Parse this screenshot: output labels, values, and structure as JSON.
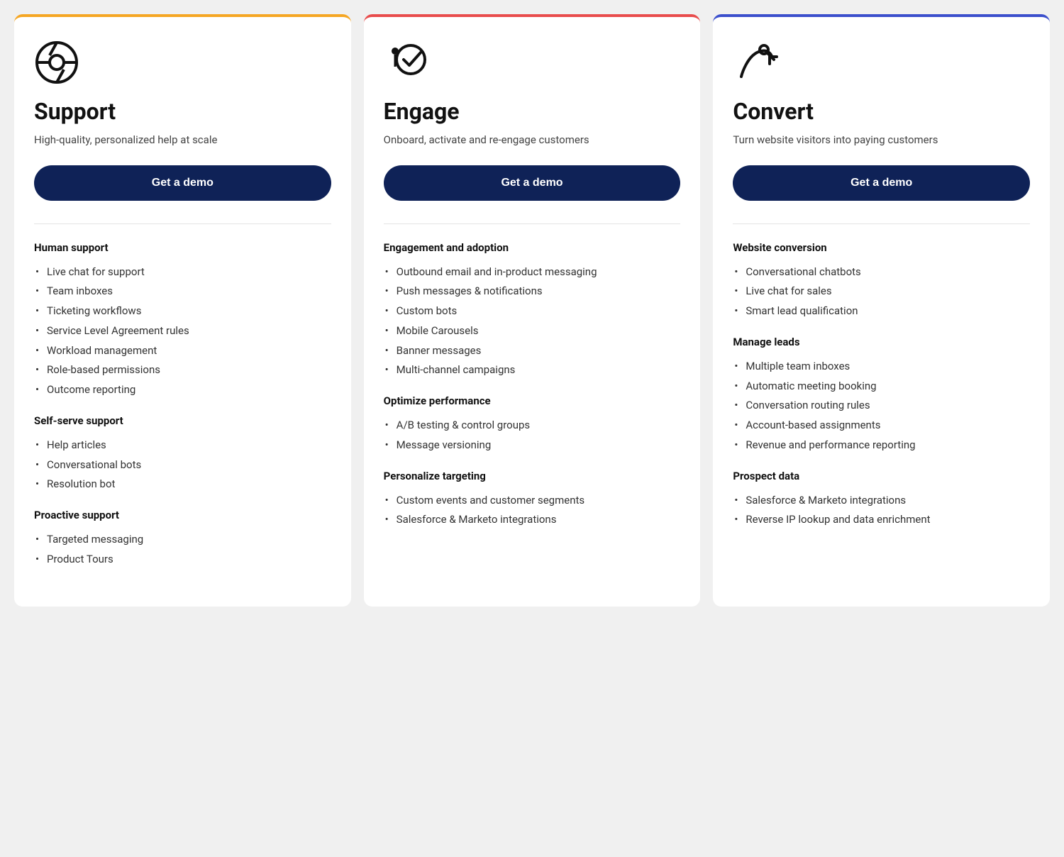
{
  "cards": [
    {
      "id": "support",
      "borderClass": "card-support",
      "icon": "support-icon",
      "title": "Support",
      "subtitle": "High-quality, personalized help at scale",
      "demoLabel": "Get a demo",
      "sections": [
        {
          "heading": "Human support",
          "items": [
            "Live chat for support",
            "Team inboxes",
            "Ticketing workflows",
            "Service Level Agreement rules",
            "Workload management",
            "Role-based permissions",
            "Outcome reporting"
          ]
        },
        {
          "heading": "Self-serve support",
          "items": [
            "Help articles",
            "Conversational bots",
            "Resolution bot"
          ]
        },
        {
          "heading": "Proactive support",
          "items": [
            "Targeted messaging",
            "Product Tours"
          ]
        }
      ]
    },
    {
      "id": "engage",
      "borderClass": "card-engage",
      "icon": "engage-icon",
      "title": "Engage",
      "subtitle": "Onboard, activate and re-engage customers",
      "demoLabel": "Get a demo",
      "sections": [
        {
          "heading": "Engagement and adoption",
          "items": [
            "Outbound email and in-product messaging",
            "Push messages & notifications",
            "Custom bots",
            "Mobile Carousels",
            "Banner messages",
            "Multi-channel campaigns"
          ]
        },
        {
          "heading": "Optimize performance",
          "items": [
            "A/B testing & control groups",
            "Message versioning"
          ]
        },
        {
          "heading": "Personalize targeting",
          "items": [
            "Custom events and customer segments",
            "Salesforce & Marketo integrations"
          ]
        }
      ]
    },
    {
      "id": "convert",
      "borderClass": "card-convert",
      "icon": "convert-icon",
      "title": "Convert",
      "subtitle": "Turn website visitors into paying customers",
      "demoLabel": "Get a demo",
      "sections": [
        {
          "heading": "Website conversion",
          "items": [
            "Conversational chatbots",
            "Live chat for sales",
            "Smart lead qualification"
          ]
        },
        {
          "heading": "Manage leads",
          "items": [
            "Multiple team inboxes",
            "Automatic meeting booking",
            "Conversation routing rules",
            "Account-based assignments",
            "Revenue and performance reporting"
          ]
        },
        {
          "heading": "Prospect data",
          "items": [
            "Salesforce & Marketo integrations",
            "Reverse IP lookup and data enrichment"
          ]
        }
      ]
    }
  ]
}
